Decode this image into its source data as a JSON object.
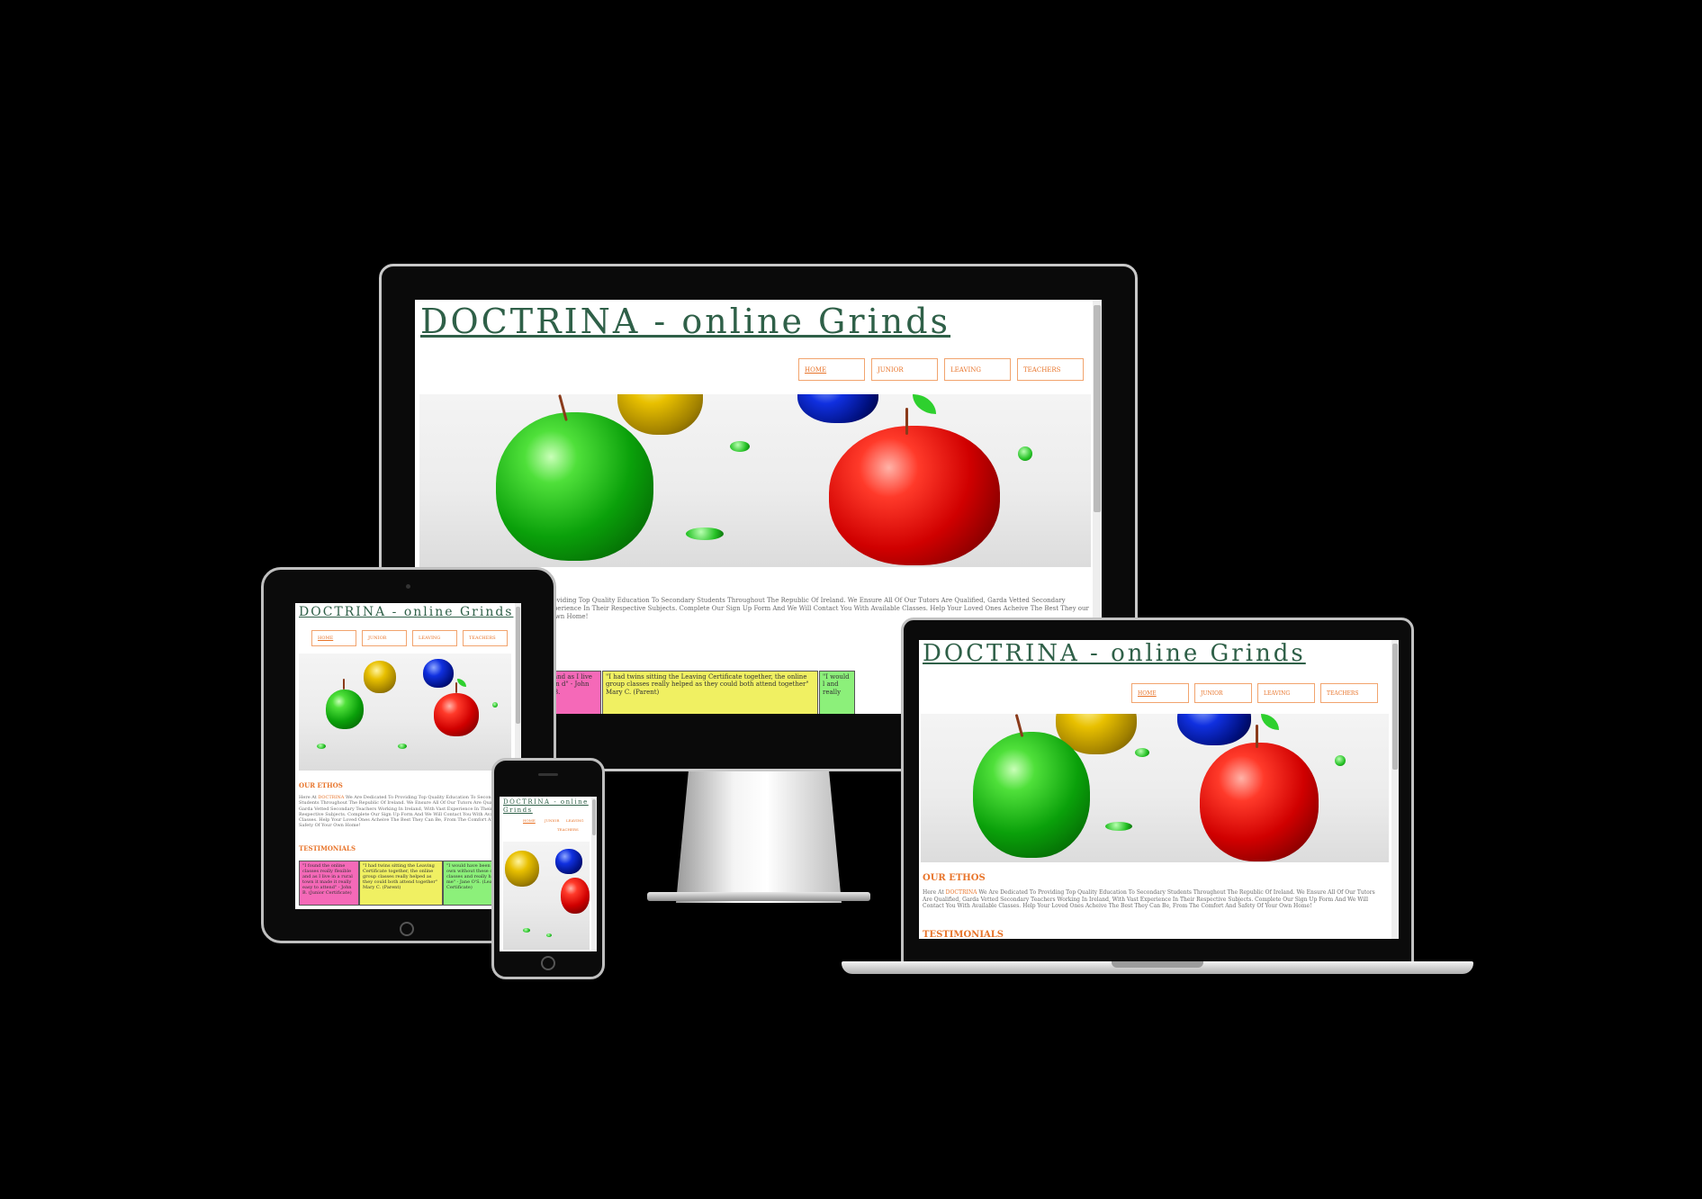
{
  "site": {
    "title": "DOCTRINA - online Grinds",
    "nav": [
      "HOME",
      "JUNIOR",
      "LEAVING",
      "TEACHERS"
    ],
    "ethos_heading": "OUR ETHOS",
    "ethos_intro_prefix": "Here At ",
    "ethos_brand": "DOCTRINA",
    "ethos_body": " We Are Dedicated To Providing Top Quality Education To Secondary Students Throughout The Republic Of Ireland. We Ensure All Of Our Tutors Are Qualified, Garda Vetted Secondary Teachers Working In Ireland, With Vast Experience In Their Respective Subjects. Complete Our Sign Up Form And We Will Contact You With Available Classes. Help Your Loved Ones Acheive The Best They Can Be, From The Comfort And Safety Of Your Own Home!",
    "testimonials_heading": "TESTIMONIALS",
    "testimonials": [
      "\"I found the online classes really flexible and as I live in a rural town it made it really easy to attend\" - John B. (Junior Certificate)",
      "\"I had twins sitting the Leaving Certificate together, the online group classes really helped as they could both attend together\" Mary C. (Parent)",
      "\"I would have been on my own without these online classes and really helped me\" - Jane O'S. (Leaving Certificate)"
    ]
  },
  "desktop": {
    "ethos_visible": "roviding Top Quality Education To Secondary Students Throughout The Republic Of Ireland. We Ensure All Of Our Tutors Are Qualified, Garda Vetted Secondary xperience In Their Respective Subjects. Complete Our Sign Up Form And We Will Contact You With Available Classes. Help Your Loved Ones Acheive The Best They our Own Home!",
    "testi_visible": [
      "and as I live in d\" - John B.",
      "\"I had twins sitting the Leaving Certificate together, the online group classes really helped as they could both attend together\" Mary C. (Parent)",
      "\"I would l and really"
    ]
  },
  "tablet": {
    "testi_visible": [
      "\"I found the online classes really flexible and as I live in a rural town it made it really easy to attend\" - John B. (Junior Certificate)",
      "\"I had twins sitting the Leaving Certificate together, the online group classes really helped as they could both attend together\" Mary C. (Parent)",
      "\"I would have been on my own without these online classes and really helped me\" - Jane O'S. (Leaving Certificate)"
    ]
  },
  "phone": {
    "title_line1": "DOCTRINA - online",
    "title_line2": "Grinds"
  },
  "laptop": {
    "testimonials_partial": "TESTIMONIALS"
  }
}
